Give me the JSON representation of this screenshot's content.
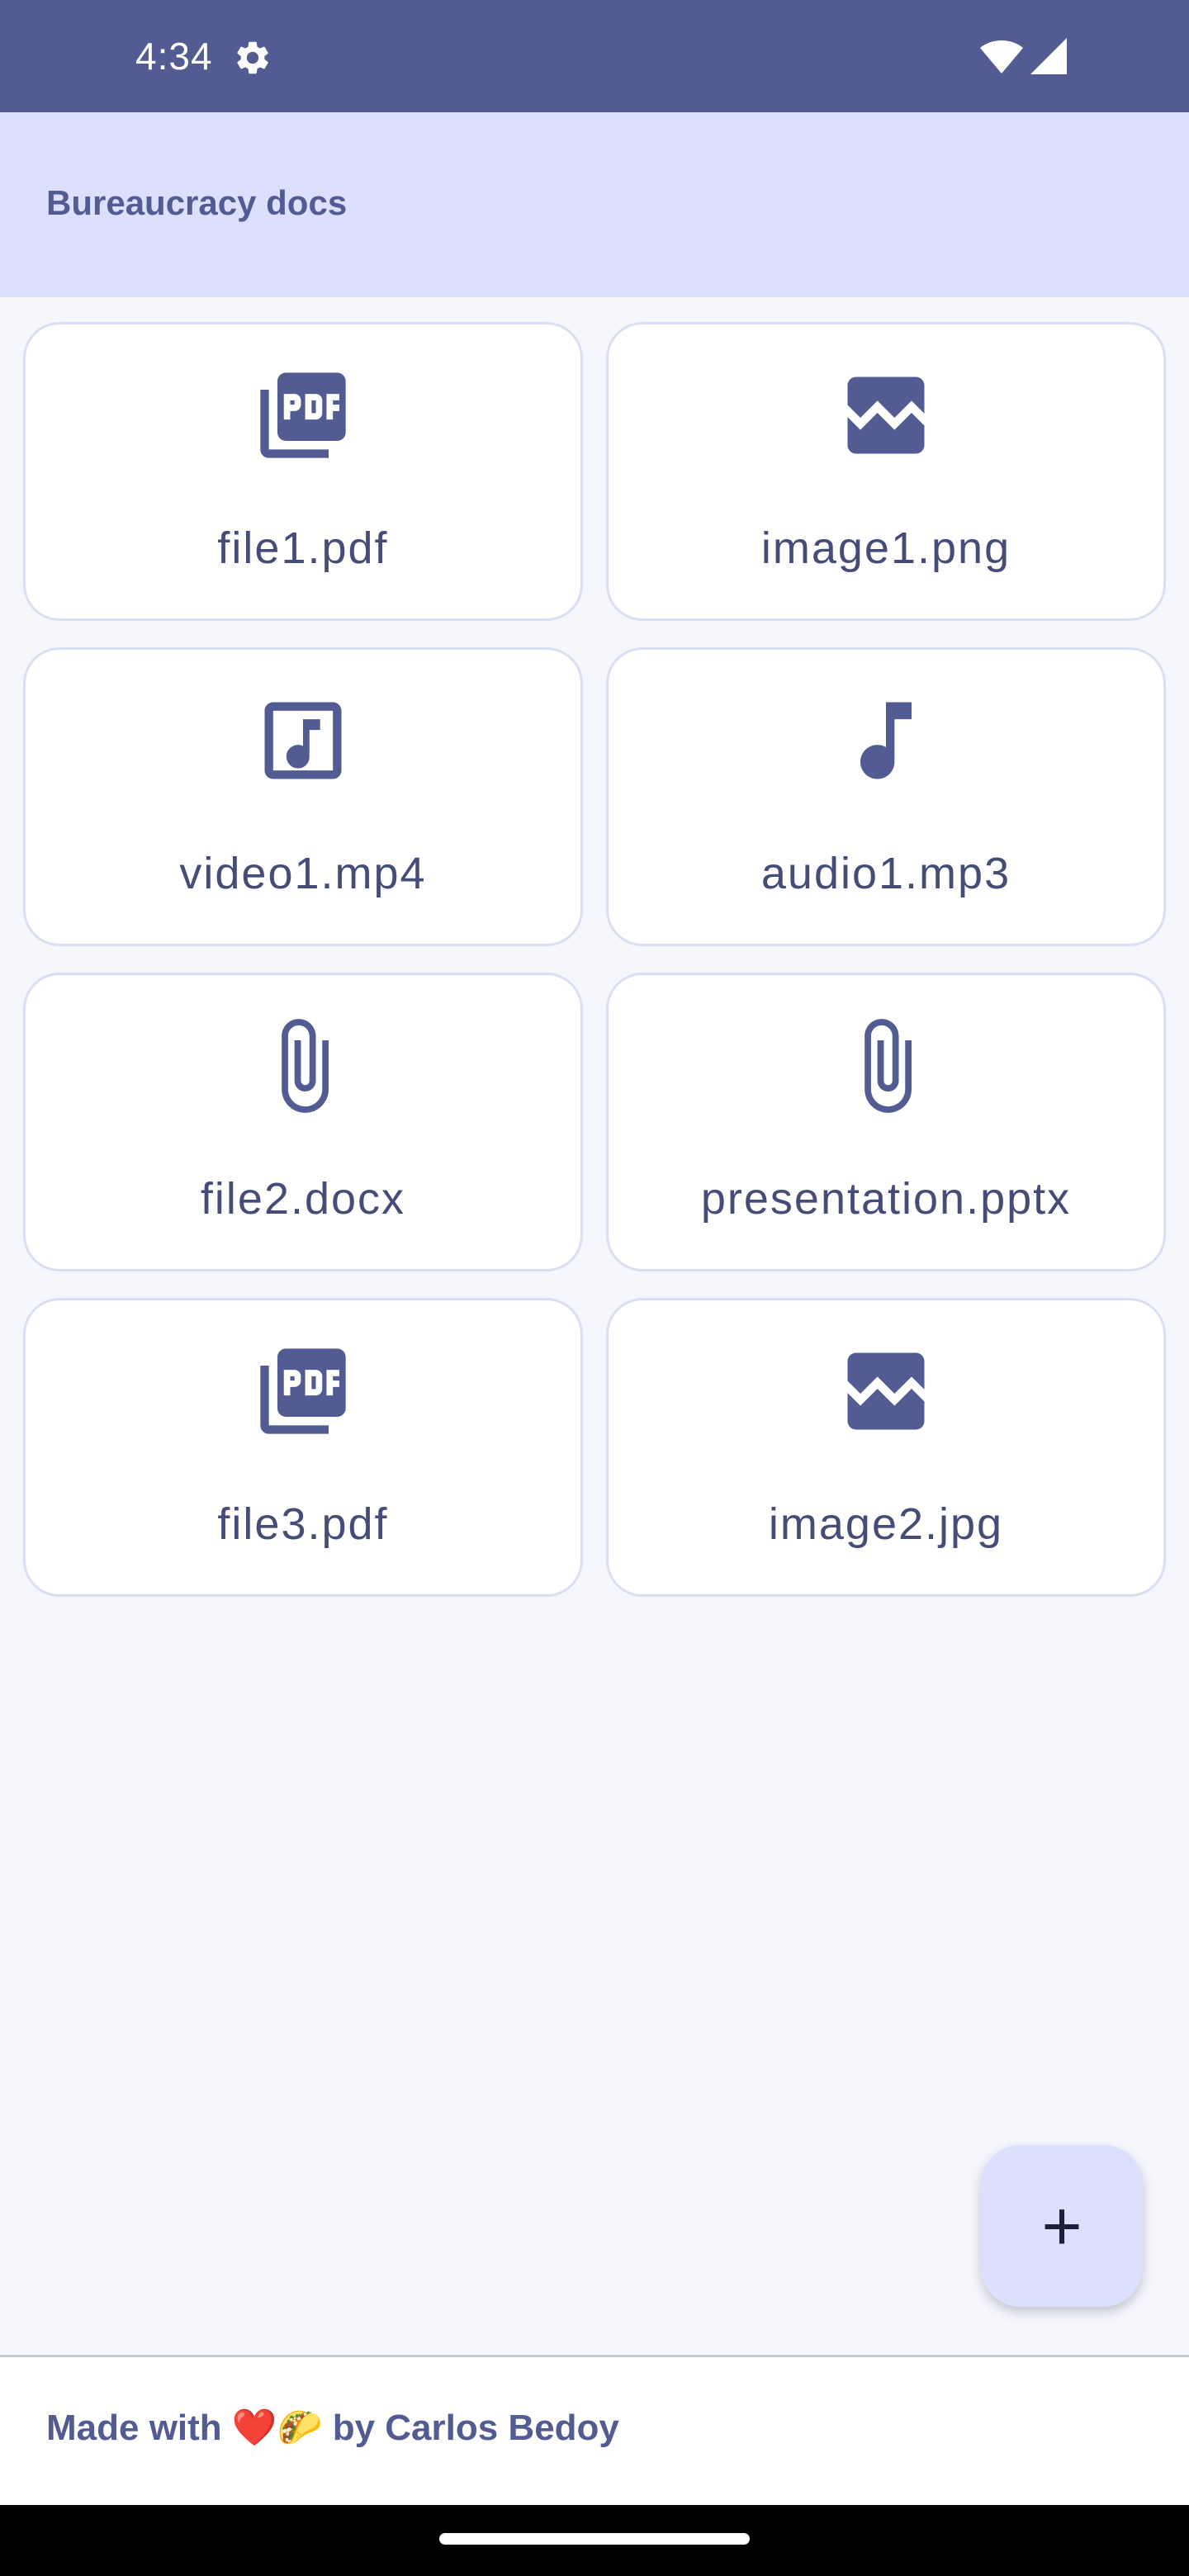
{
  "status_bar": {
    "time": "4:34",
    "icons": [
      "gear-icon",
      "wifi-icon",
      "signal-icon"
    ]
  },
  "app_bar": {
    "title": "Bureaucracy docs"
  },
  "files": [
    {
      "name": "file1.pdf",
      "icon": "pdf-icon"
    },
    {
      "name": "image1.png",
      "icon": "image-icon"
    },
    {
      "name": "video1.mp4",
      "icon": "video-icon"
    },
    {
      "name": "audio1.mp3",
      "icon": "music-note-icon"
    },
    {
      "name": "file2.docx",
      "icon": "attachment-icon"
    },
    {
      "name": "presentation.pptx",
      "icon": "attachment-icon"
    },
    {
      "name": "file3.pdf",
      "icon": "pdf-icon"
    },
    {
      "name": "image2.jpg",
      "icon": "image-icon"
    }
  ],
  "fab": {
    "glyph": "+",
    "icon": "add-icon"
  },
  "footer": {
    "text": "Made with ❤️🌮 by Carlos Bedoy"
  },
  "colors": {
    "primary": "#525c93",
    "app_bar_bg": "#dde0fd",
    "background": "#f6f7fd",
    "tile_border": "#dcdff3"
  }
}
